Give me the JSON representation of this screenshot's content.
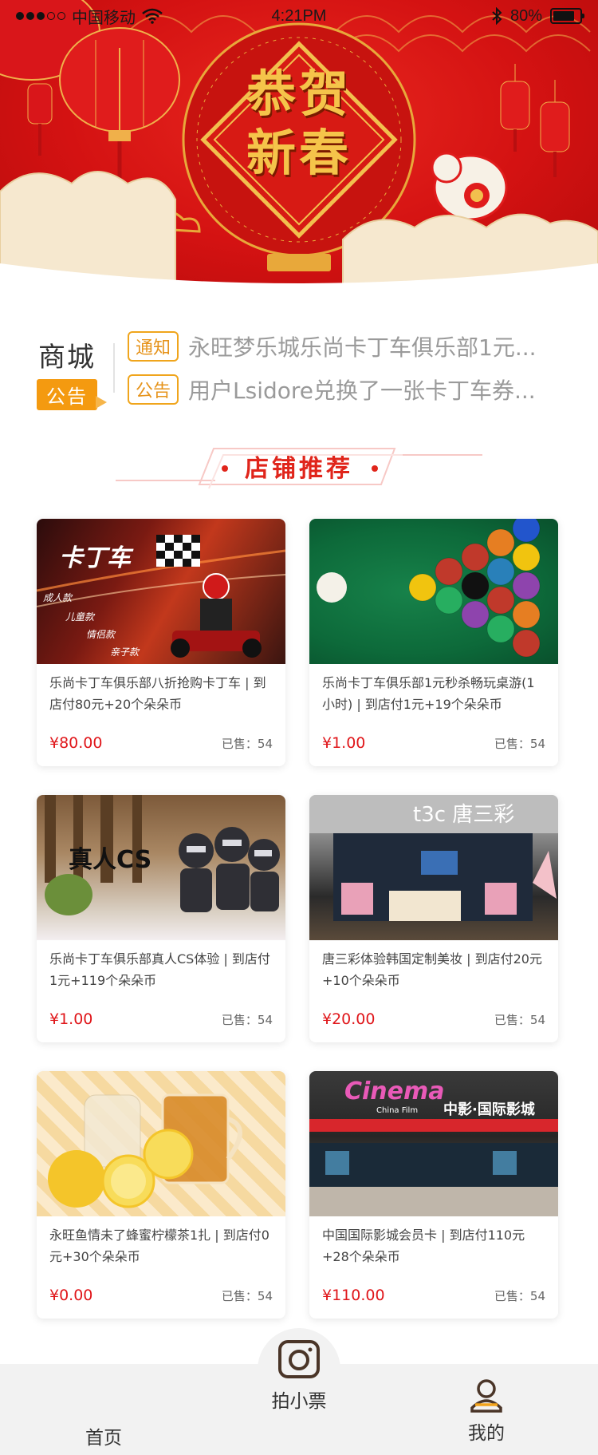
{
  "status_bar": {
    "carrier": "中国移动",
    "time": "4:21PM",
    "battery": "80%",
    "battery_level": 0.8
  },
  "banner": {
    "line1": "恭贺",
    "line2": "新春"
  },
  "notice": {
    "brand_top": "商城",
    "brand_bottom": "公告",
    "items": [
      {
        "tag": "通知",
        "text": "永旺梦乐城乐尚卡丁车俱乐部1元..."
      },
      {
        "tag": "公告",
        "text": "用户Lsidore兑换了一张卡丁车券..."
      }
    ]
  },
  "section": {
    "title": "店铺推荐"
  },
  "products": [
    {
      "title": "乐尚卡丁车俱乐部八折抢购卡丁车 | 到店付80元+20个朵朵币",
      "price": "¥80.00",
      "sold": "已售：54",
      "image": "kart-racing-image",
      "image_texts": {
        "main": "卡丁车",
        "l1": "成人款",
        "l2": "儿童款",
        "l3": "情侣款",
        "l4": "亲子款"
      }
    },
    {
      "title": "乐尚卡丁车俱乐部1元秒杀畅玩桌游(1小时) | 到店付1元+19个朵朵币",
      "price": "¥1.00",
      "sold": "已售：54",
      "image": "billiards-image"
    },
    {
      "title": "乐尚卡丁车俱乐部真人CS体验 | 到店付1元+119个朵朵币",
      "price": "¥1.00",
      "sold": "已售：54",
      "image": "real-cs-image",
      "image_texts": {
        "main": "真人CS"
      }
    },
    {
      "title": "唐三彩体验韩国定制美妆 | 到店付20元+10个朵朵币",
      "price": "¥20.00",
      "sold": "已售：54",
      "image": "tangsancai-store-image",
      "image_texts": {
        "main": "t3c 唐三彩"
      }
    },
    {
      "title": "永旺鱼情未了蜂蜜柠檬茶1扎 | 到店付0元+30个朵朵币",
      "price": "¥0.00",
      "sold": "已售：54",
      "image": "lemon-tea-image"
    },
    {
      "title": "中国国际影城会员卡 | 到店付110元+28个朵朵币",
      "price": "¥110.00",
      "sold": "已售：54",
      "image": "cinema-image",
      "image_texts": {
        "main": "Cinema",
        "sub": "China Film",
        "sign": "中影·国际影城"
      }
    }
  ],
  "tabbar": {
    "home": "首页",
    "center": "拍小票",
    "mine": "我的"
  },
  "colors": {
    "accent_red": "#e0251b",
    "price_red": "#e0161a",
    "notice_orange": "#f49a10"
  }
}
